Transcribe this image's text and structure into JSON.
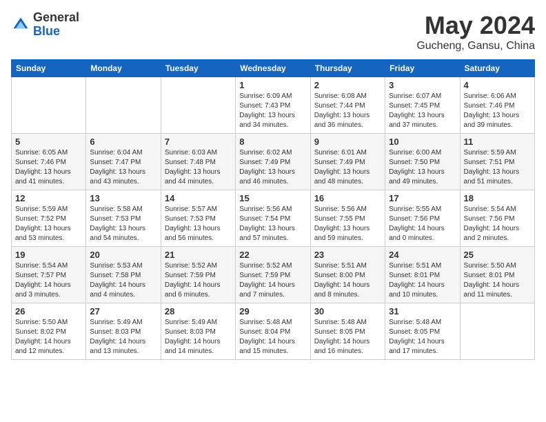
{
  "header": {
    "logo_general": "General",
    "logo_blue": "Blue",
    "title": "May 2024",
    "subtitle": "Gucheng, Gansu, China"
  },
  "weekdays": [
    "Sunday",
    "Monday",
    "Tuesday",
    "Wednesday",
    "Thursday",
    "Friday",
    "Saturday"
  ],
  "weeks": [
    [
      {
        "day": "",
        "info": ""
      },
      {
        "day": "",
        "info": ""
      },
      {
        "day": "",
        "info": ""
      },
      {
        "day": "1",
        "info": "Sunrise: 6:09 AM\nSunset: 7:43 PM\nDaylight: 13 hours\nand 34 minutes."
      },
      {
        "day": "2",
        "info": "Sunrise: 6:08 AM\nSunset: 7:44 PM\nDaylight: 13 hours\nand 36 minutes."
      },
      {
        "day": "3",
        "info": "Sunrise: 6:07 AM\nSunset: 7:45 PM\nDaylight: 13 hours\nand 37 minutes."
      },
      {
        "day": "4",
        "info": "Sunrise: 6:06 AM\nSunset: 7:46 PM\nDaylight: 13 hours\nand 39 minutes."
      }
    ],
    [
      {
        "day": "5",
        "info": "Sunrise: 6:05 AM\nSunset: 7:46 PM\nDaylight: 13 hours\nand 41 minutes."
      },
      {
        "day": "6",
        "info": "Sunrise: 6:04 AM\nSunset: 7:47 PM\nDaylight: 13 hours\nand 43 minutes."
      },
      {
        "day": "7",
        "info": "Sunrise: 6:03 AM\nSunset: 7:48 PM\nDaylight: 13 hours\nand 44 minutes."
      },
      {
        "day": "8",
        "info": "Sunrise: 6:02 AM\nSunset: 7:49 PM\nDaylight: 13 hours\nand 46 minutes."
      },
      {
        "day": "9",
        "info": "Sunrise: 6:01 AM\nSunset: 7:49 PM\nDaylight: 13 hours\nand 48 minutes."
      },
      {
        "day": "10",
        "info": "Sunrise: 6:00 AM\nSunset: 7:50 PM\nDaylight: 13 hours\nand 49 minutes."
      },
      {
        "day": "11",
        "info": "Sunrise: 5:59 AM\nSunset: 7:51 PM\nDaylight: 13 hours\nand 51 minutes."
      }
    ],
    [
      {
        "day": "12",
        "info": "Sunrise: 5:59 AM\nSunset: 7:52 PM\nDaylight: 13 hours\nand 53 minutes."
      },
      {
        "day": "13",
        "info": "Sunrise: 5:58 AM\nSunset: 7:53 PM\nDaylight: 13 hours\nand 54 minutes."
      },
      {
        "day": "14",
        "info": "Sunrise: 5:57 AM\nSunset: 7:53 PM\nDaylight: 13 hours\nand 56 minutes."
      },
      {
        "day": "15",
        "info": "Sunrise: 5:56 AM\nSunset: 7:54 PM\nDaylight: 13 hours\nand 57 minutes."
      },
      {
        "day": "16",
        "info": "Sunrise: 5:56 AM\nSunset: 7:55 PM\nDaylight: 13 hours\nand 59 minutes."
      },
      {
        "day": "17",
        "info": "Sunrise: 5:55 AM\nSunset: 7:56 PM\nDaylight: 14 hours\nand 0 minutes."
      },
      {
        "day": "18",
        "info": "Sunrise: 5:54 AM\nSunset: 7:56 PM\nDaylight: 14 hours\nand 2 minutes."
      }
    ],
    [
      {
        "day": "19",
        "info": "Sunrise: 5:54 AM\nSunset: 7:57 PM\nDaylight: 14 hours\nand 3 minutes."
      },
      {
        "day": "20",
        "info": "Sunrise: 5:53 AM\nSunset: 7:58 PM\nDaylight: 14 hours\nand 4 minutes."
      },
      {
        "day": "21",
        "info": "Sunrise: 5:52 AM\nSunset: 7:59 PM\nDaylight: 14 hours\nand 6 minutes."
      },
      {
        "day": "22",
        "info": "Sunrise: 5:52 AM\nSunset: 7:59 PM\nDaylight: 14 hours\nand 7 minutes."
      },
      {
        "day": "23",
        "info": "Sunrise: 5:51 AM\nSunset: 8:00 PM\nDaylight: 14 hours\nand 8 minutes."
      },
      {
        "day": "24",
        "info": "Sunrise: 5:51 AM\nSunset: 8:01 PM\nDaylight: 14 hours\nand 10 minutes."
      },
      {
        "day": "25",
        "info": "Sunrise: 5:50 AM\nSunset: 8:01 PM\nDaylight: 14 hours\nand 11 minutes."
      }
    ],
    [
      {
        "day": "26",
        "info": "Sunrise: 5:50 AM\nSunset: 8:02 PM\nDaylight: 14 hours\nand 12 minutes."
      },
      {
        "day": "27",
        "info": "Sunrise: 5:49 AM\nSunset: 8:03 PM\nDaylight: 14 hours\nand 13 minutes."
      },
      {
        "day": "28",
        "info": "Sunrise: 5:49 AM\nSunset: 8:03 PM\nDaylight: 14 hours\nand 14 minutes."
      },
      {
        "day": "29",
        "info": "Sunrise: 5:48 AM\nSunset: 8:04 PM\nDaylight: 14 hours\nand 15 minutes."
      },
      {
        "day": "30",
        "info": "Sunrise: 5:48 AM\nSunset: 8:05 PM\nDaylight: 14 hours\nand 16 minutes."
      },
      {
        "day": "31",
        "info": "Sunrise: 5:48 AM\nSunset: 8:05 PM\nDaylight: 14 hours\nand 17 minutes."
      },
      {
        "day": "",
        "info": ""
      }
    ]
  ]
}
